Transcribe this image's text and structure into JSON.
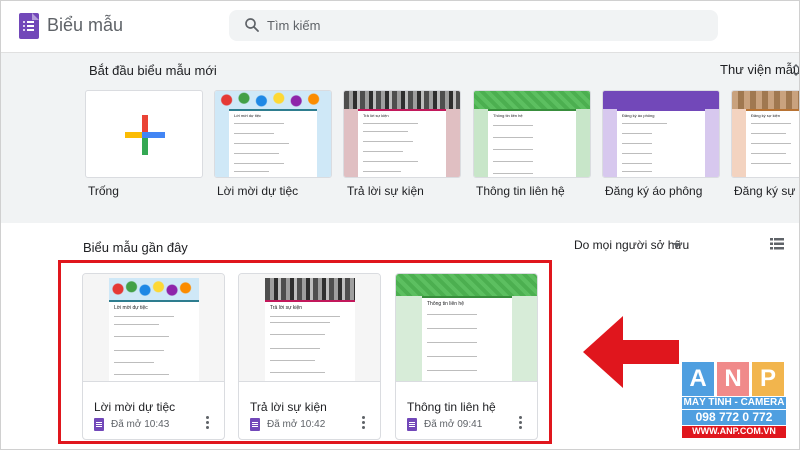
{
  "header": {
    "app_title": "Biểu mẫu",
    "search_placeholder": "Tìm kiếm"
  },
  "templates": {
    "section_title": "Bắt đầu biểu mẫu mới",
    "gallery_link": "Thư viện mẫu",
    "items": [
      {
        "label": "Trống",
        "thumb_title": ""
      },
      {
        "label": "Lời mời dự tiệc",
        "thumb_title": "Lời mời dự tiệc"
      },
      {
        "label": "Trả lời sự kiện",
        "thumb_title": "Trả lời sự kiện"
      },
      {
        "label": "Thông tin liên hệ",
        "thumb_title": "Thông tin liên hệ"
      },
      {
        "label": "Đăng ký áo phông",
        "thumb_title": "Đăng ký áo phông"
      },
      {
        "label": "Đăng ký sự kiện",
        "thumb_title": "Đăng ký sự kiện"
      }
    ]
  },
  "recent": {
    "section_title": "Biểu mẫu gần đây",
    "owner_filter": "Do mọi người sở hữu",
    "docs": [
      {
        "name": "Lời mời dự tiệc",
        "opened": "Đã mở 10:43",
        "thumb_title": "Lời mời dự tiệc"
      },
      {
        "name": "Trả lời sự kiện",
        "opened": "Đã mở 10:42",
        "thumb_title": "Trả lời sự kiện"
      },
      {
        "name": "Thông tin liên hệ",
        "opened": "Đã mở 09:41",
        "thumb_title": "Thông tin liên hệ"
      }
    ]
  },
  "watermark": {
    "letters": [
      "A",
      "N",
      "P"
    ],
    "line1": "MÁY TÍNH - CAMERA",
    "line2": "098 772 0 772",
    "line3": "WWW.ANP.COM.VN"
  },
  "colors": {
    "brand_purple": "#7248b9",
    "highlight_red": "#e0161d",
    "band_gray": "#f1f3f4"
  },
  "icons": {
    "logo": "forms-logo-icon",
    "search": "search-icon",
    "more": "more-vert-icon",
    "list_view": "list-view-icon",
    "arrow": "left-arrow-icon"
  }
}
